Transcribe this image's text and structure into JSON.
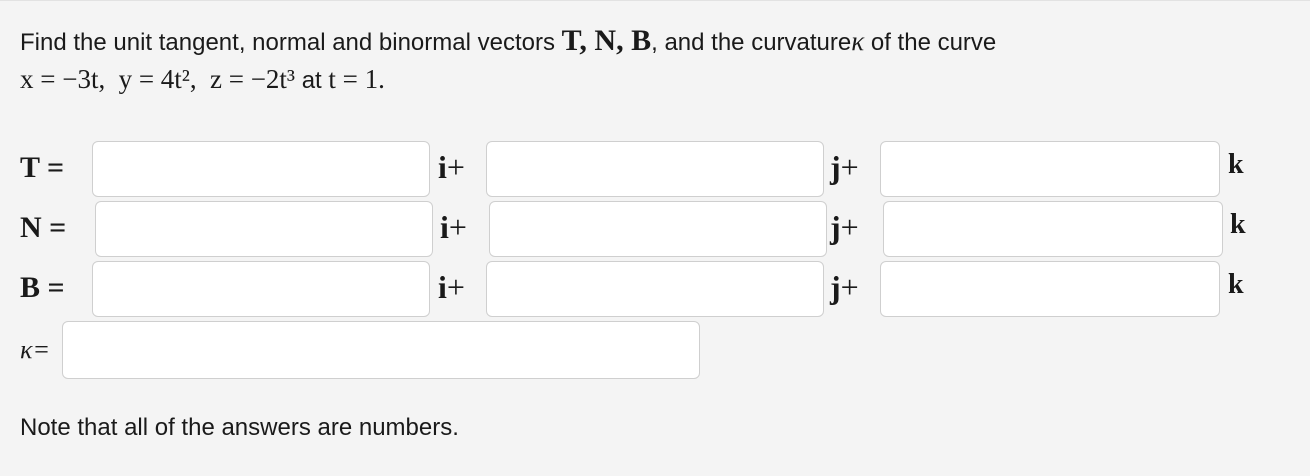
{
  "problem": {
    "intro": "Find the unit tangent, normal and binormal vectors",
    "vectors_symbols": "T, N, B",
    "and_curvature": ", and the curvature",
    "kappa_symbol": "κ",
    "of_the_curve": " of the curve",
    "equation_x": "x = −3t,",
    "equation_y": "y = 4t²,",
    "equation_z": "z = −2t³",
    "at_text": "at",
    "t_value": "t = 1."
  },
  "rows": [
    {
      "label": "T =",
      "i_unit": "i",
      "j_unit": "j",
      "k_unit": "k",
      "plus": "+"
    },
    {
      "label": "N =",
      "i_unit": "i",
      "j_unit": "j",
      "k_unit": "k",
      "plus": "+"
    },
    {
      "label": "B =",
      "i_unit": "i",
      "j_unit": "j",
      "k_unit": "k",
      "plus": "+"
    }
  ],
  "curvature": {
    "label": "κ="
  },
  "note": "Note that all of the answers are numbers."
}
